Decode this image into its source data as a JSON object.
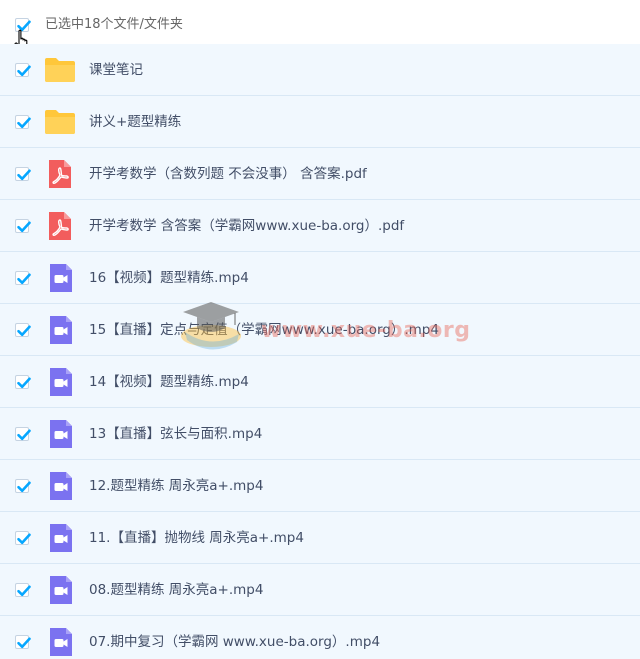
{
  "header": {
    "selected_text": "已选中18个文件/文件夹",
    "checked": true
  },
  "files": [
    {
      "name": "课堂笔记",
      "icon": "folder-icon",
      "type": "folder"
    },
    {
      "name": "讲义+题型精练",
      "icon": "folder-icon",
      "type": "folder"
    },
    {
      "name": "开学考数学（含数列题 不会没事） 含答案.pdf",
      "icon": "pdf-icon",
      "type": "pdf"
    },
    {
      "name": "开学考数学 含答案（学霸网www.xue-ba.org）.pdf",
      "icon": "pdf-icon",
      "type": "pdf"
    },
    {
      "name": "16【视频】题型精练.mp4",
      "icon": "video-icon",
      "type": "video"
    },
    {
      "name": "15【直播】定点与定值（学霸网www.xue-ba.org）.mp4",
      "icon": "video-icon",
      "type": "video"
    },
    {
      "name": "14【视频】题型精练.mp4",
      "icon": "video-icon",
      "type": "video"
    },
    {
      "name": "13【直播】弦长与面积.mp4",
      "icon": "video-icon",
      "type": "video"
    },
    {
      "name": "12.题型精练 周永亮a+.mp4",
      "icon": "video-icon",
      "type": "video"
    },
    {
      "name": "11.【直播】抛物线 周永亮a+.mp4",
      "icon": "video-icon",
      "type": "video"
    },
    {
      "name": "08.题型精练 周永亮a+.mp4",
      "icon": "video-icon",
      "type": "video"
    },
    {
      "name": "07.期中复习（学霸网 www.xue-ba.org）.mp4",
      "icon": "video-icon",
      "type": "video"
    }
  ],
  "watermark": {
    "text": "www.xue-ba.org"
  },
  "colors": {
    "check": "#06a7ff",
    "folder": "#ffc73a",
    "pdf": "#f25d5d",
    "video": "#7b72f0",
    "row_bg": "#f1f8fe",
    "row_border": "#d9e8f5",
    "text": "#424e67"
  }
}
